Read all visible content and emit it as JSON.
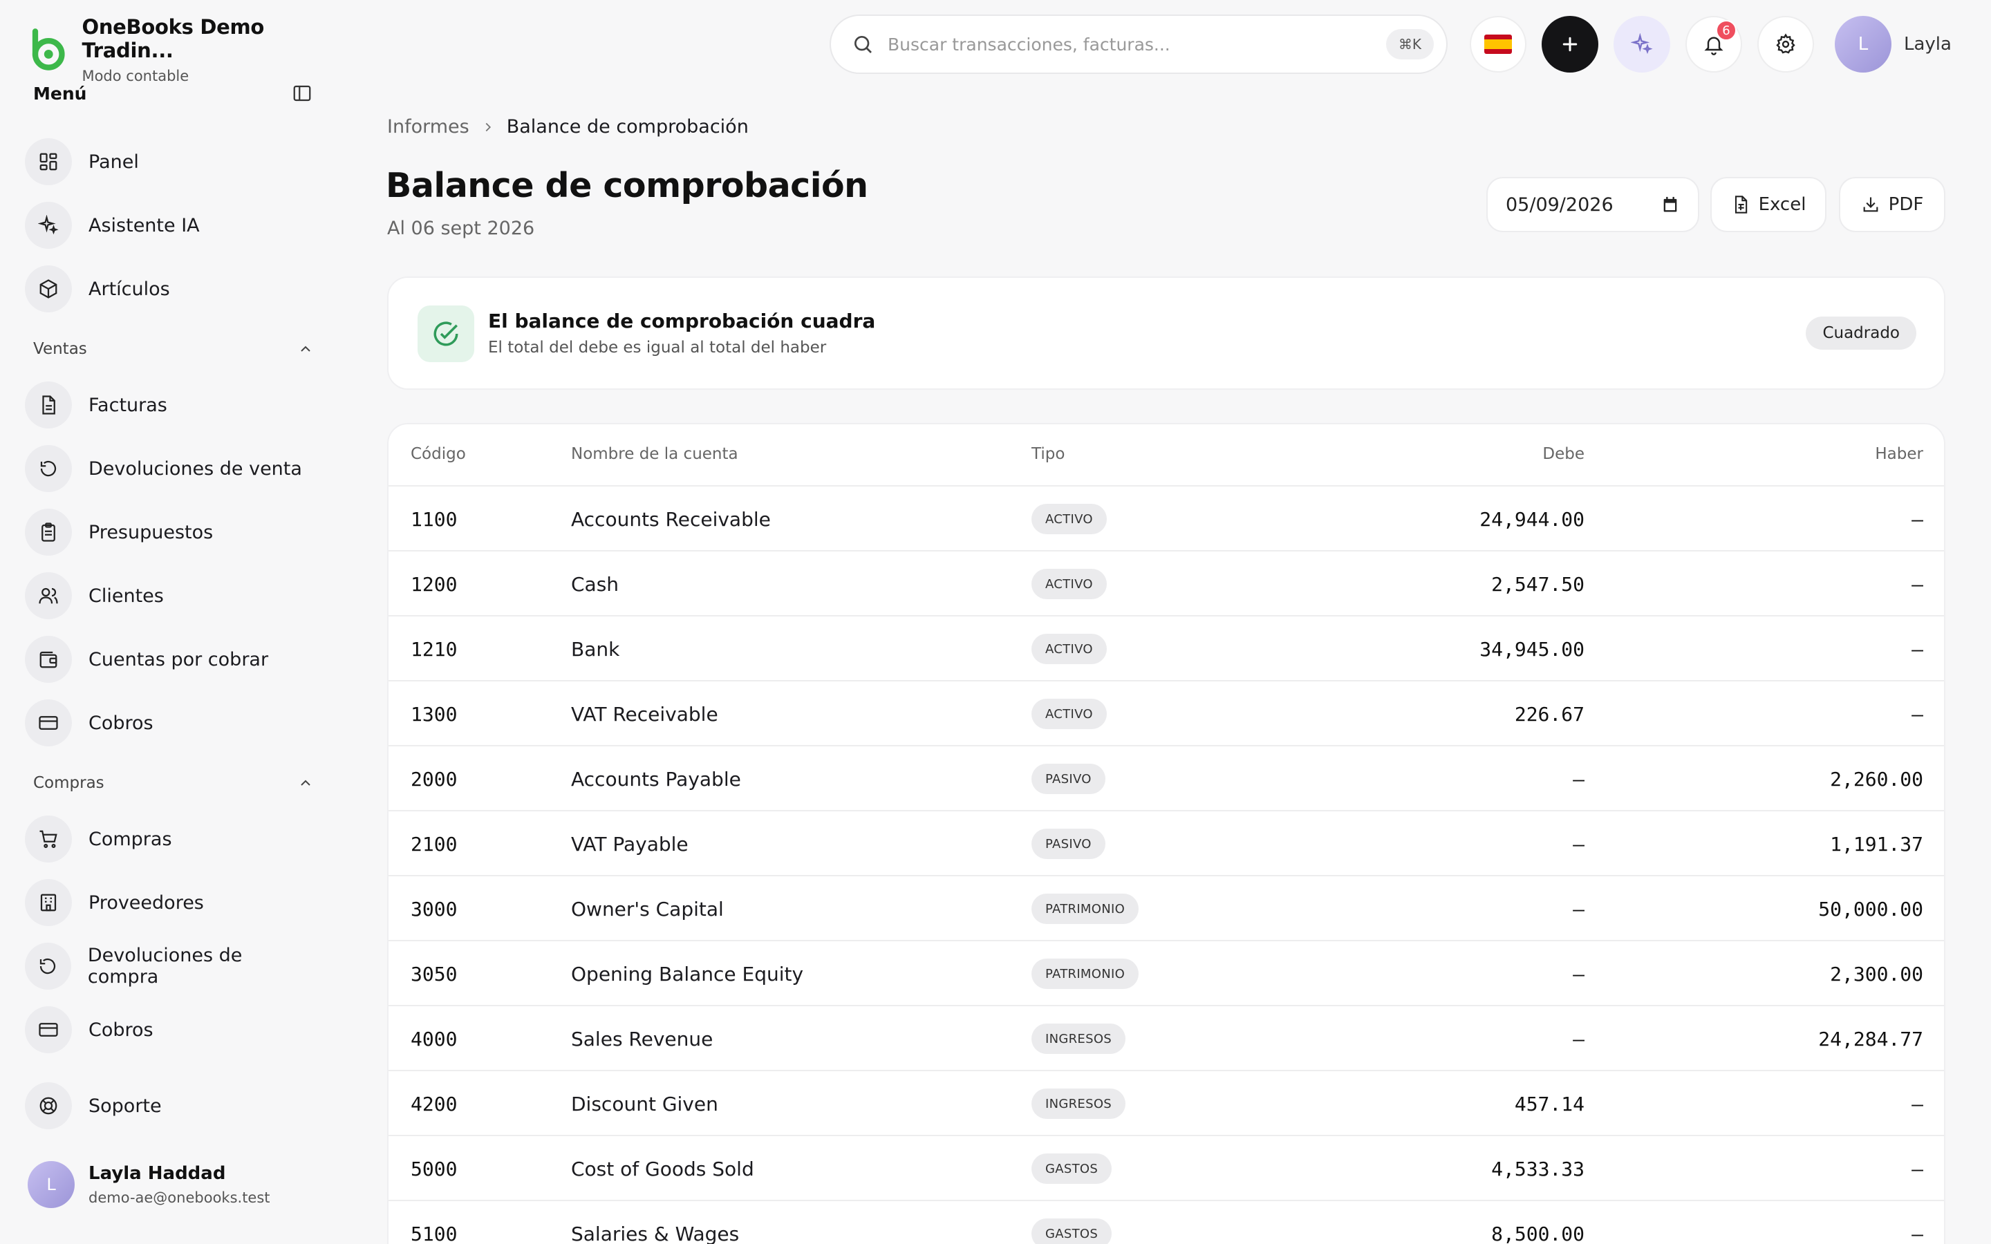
{
  "app": {
    "name": "OneBooks Demo Tradin...",
    "mode": "Modo contable"
  },
  "sidebar": {
    "menu_title": "Menú",
    "top_items": [
      {
        "label": "Panel",
        "icon": "dashboard-icon"
      },
      {
        "label": "Asistente IA",
        "icon": "sparkles-icon"
      },
      {
        "label": "Artículos",
        "icon": "box-icon"
      }
    ],
    "sections": [
      {
        "label": "Ventas",
        "items": [
          {
            "label": "Facturas",
            "icon": "document-icon"
          },
          {
            "label": "Devoluciones de venta",
            "icon": "undo-icon"
          },
          {
            "label": "Presupuestos",
            "icon": "clipboard-icon"
          },
          {
            "label": "Clientes",
            "icon": "users-icon"
          },
          {
            "label": "Cuentas por cobrar",
            "icon": "wallet-icon"
          },
          {
            "label": "Cobros",
            "icon": "card-icon"
          }
        ]
      },
      {
        "label": "Compras",
        "items": [
          {
            "label": "Compras",
            "icon": "cart-icon"
          },
          {
            "label": "Proveedores",
            "icon": "building-icon"
          },
          {
            "label": "Devoluciones de compra",
            "icon": "undo-icon"
          },
          {
            "label": "Cobros",
            "icon": "card-icon"
          }
        ]
      }
    ],
    "support_label": "Soporte",
    "user": {
      "initial": "L",
      "name": "Layla Haddad",
      "email": "demo-ae@onebooks.test"
    }
  },
  "topbar": {
    "search_placeholder": "Buscar transacciones, facturas...",
    "search_shortcut": "⌘K",
    "notification_count": "6",
    "user_initial": "L",
    "user_name": "Layla"
  },
  "breadcrumb": {
    "parent": "Informes",
    "current": "Balance de comprobación"
  },
  "page": {
    "title": "Balance de comprobación",
    "subtitle": "Al 06 sept 2026",
    "date_value": "05/09/2026",
    "excel_label": "Excel",
    "pdf_label": "PDF"
  },
  "balance_check": {
    "title": "El balance de comprobación cuadra",
    "subtitle": "El total del debe es igual al total del haber",
    "status": "Cuadrado"
  },
  "table": {
    "headers": {
      "code": "Código",
      "name": "Nombre de la cuenta",
      "type": "Tipo",
      "debit": "Debe",
      "credit": "Haber"
    },
    "rows": [
      {
        "code": "1100",
        "name": "Accounts Receivable",
        "type": "ACTIVO",
        "debit": "24,944.00",
        "credit": "–"
      },
      {
        "code": "1200",
        "name": "Cash",
        "type": "ACTIVO",
        "debit": "2,547.50",
        "credit": "–"
      },
      {
        "code": "1210",
        "name": "Bank",
        "type": "ACTIVO",
        "debit": "34,945.00",
        "credit": "–"
      },
      {
        "code": "1300",
        "name": "VAT Receivable",
        "type": "ACTIVO",
        "debit": "226.67",
        "credit": "–"
      },
      {
        "code": "2000",
        "name": "Accounts Payable",
        "type": "PASIVO",
        "debit": "–",
        "credit": "2,260.00"
      },
      {
        "code": "2100",
        "name": "VAT Payable",
        "type": "PASIVO",
        "debit": "–",
        "credit": "1,191.37"
      },
      {
        "code": "3000",
        "name": "Owner's Capital",
        "type": "PATRIMONIO",
        "debit": "–",
        "credit": "50,000.00"
      },
      {
        "code": "3050",
        "name": "Opening Balance Equity",
        "type": "PATRIMONIO",
        "debit": "–",
        "credit": "2,300.00"
      },
      {
        "code": "4000",
        "name": "Sales Revenue",
        "type": "INGRESOS",
        "debit": "–",
        "credit": "24,284.77"
      },
      {
        "code": "4200",
        "name": "Discount Given",
        "type": "INGRESOS",
        "debit": "457.14",
        "credit": "–"
      },
      {
        "code": "5000",
        "name": "Cost of Goods Sold",
        "type": "GASTOS",
        "debit": "4,533.33",
        "credit": "–"
      },
      {
        "code": "5100",
        "name": "Salaries & Wages",
        "type": "GASTOS",
        "debit": "8,500.00",
        "credit": "–"
      }
    ]
  },
  "colors": {
    "brand_green": "#3db84a",
    "accent_dark": "#141416",
    "success_bg": "#e4f4ea",
    "success": "#2f9b5a",
    "badge_red": "#ef4e5e"
  }
}
